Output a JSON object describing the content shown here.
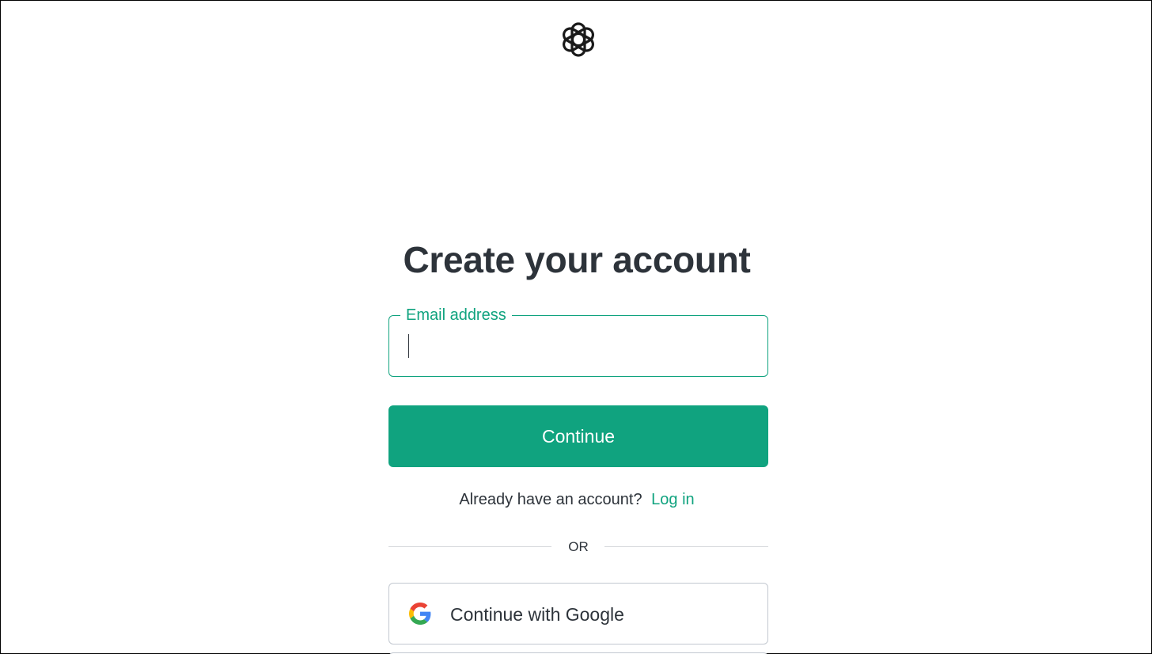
{
  "header": {
    "logo_icon": "openai-logo-icon"
  },
  "main": {
    "title": "Create your account",
    "email_field": {
      "label": "Email address",
      "value": "",
      "placeholder": ""
    },
    "continue_button_label": "Continue",
    "login_prompt": {
      "text": "Already have an account?",
      "link_label": "Log in"
    },
    "divider_label": "OR",
    "social_buttons": [
      {
        "label": "Continue with Google",
        "icon": "google-icon"
      }
    ]
  },
  "colors": {
    "accent": "#10a37f",
    "text": "#2d333a",
    "border": "#c2c8d0"
  }
}
